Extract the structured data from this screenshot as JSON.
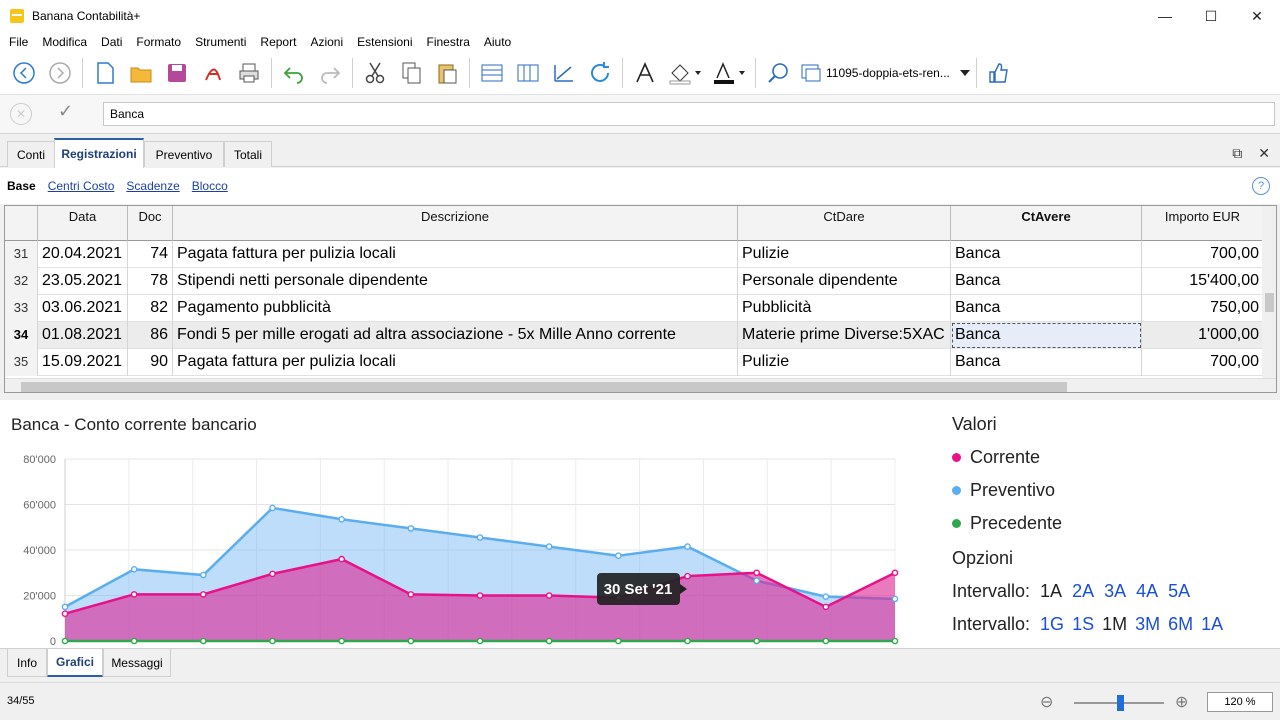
{
  "window": {
    "title": "Banana Contabilità+"
  },
  "menu": [
    "File",
    "Modifica",
    "Dati",
    "Formato",
    "Strumenti",
    "Report",
    "Azioni",
    "Estensioni",
    "Finestra",
    "Aiuto"
  ],
  "toolbar": {
    "file_name": "11095-doppia-ets-ren..."
  },
  "edit_field": {
    "value": "Banca"
  },
  "tabs": [
    "Conti",
    "Registrazioni",
    "Preventivo",
    "Totali"
  ],
  "active_tab": "Registrazioni",
  "subtabs": [
    "Base",
    "Centri Costo",
    "Scadenze",
    "Blocco"
  ],
  "table": {
    "columns": [
      "Data",
      "Doc",
      "Descrizione",
      "CtDare",
      "CtAvere",
      "Importo EUR"
    ],
    "rows": [
      {
        "n": "31",
        "data": "20.04.2021",
        "doc": "74",
        "desc": "Pagata fattura per pulizia locali",
        "dare": "Pulizie",
        "avere": "Banca",
        "importo": "700,00"
      },
      {
        "n": "32",
        "data": "23.05.2021",
        "doc": "78",
        "desc": "Stipendi netti personale dipendente",
        "dare": "Personale dipendente",
        "avere": "Banca",
        "importo": "15'400,00"
      },
      {
        "n": "33",
        "data": "03.06.2021",
        "doc": "82",
        "desc": "Pagamento pubblicità",
        "dare": "Pubblicità",
        "avere": "Banca",
        "importo": "750,00"
      },
      {
        "n": "34",
        "data": "01.08.2021",
        "doc": "86",
        "desc": "Fondi 5 per mille erogati ad altra associazione - 5x Mille Anno corrente",
        "dare": "Materie prime Diverse:5XAC",
        "avere": "Banca",
        "importo": "1'000,00"
      },
      {
        "n": "35",
        "data": "15.09.2021",
        "doc": "90",
        "desc": "Pagata fattura per pulizia locali",
        "dare": "Pulizie",
        "avere": "Banca",
        "importo": "700,00"
      }
    ]
  },
  "chart_panel": {
    "title": "Banca - Conto corrente bancario",
    "tooltip": "30 Set '21",
    "legend_heading": "Valori",
    "options_heading": "Opzioni",
    "interval_label": "Intervallo:",
    "interval_years": [
      "1A",
      "2A",
      "3A",
      "4A",
      "5A"
    ],
    "interval_periods": [
      "1G",
      "1S",
      "1M",
      "3M",
      "6M",
      "1A"
    ]
  },
  "chart_data": {
    "type": "area",
    "title": "Banca - Conto corrente bancario",
    "ylim": [
      0,
      80000
    ],
    "yticks": [
      "0",
      "20'000",
      "40'000",
      "60'000",
      "80'000"
    ],
    "grid": true,
    "legend_position": "right",
    "x_count": 14,
    "series": [
      {
        "name": "Corrente",
        "color": "#e8118a",
        "values": [
          12000,
          20500,
          20500,
          29500,
          36000,
          20500,
          20000,
          20000,
          19000,
          28500,
          30000,
          15000,
          30000
        ]
      },
      {
        "name": "Preventivo",
        "color": "#5aadee",
        "values": [
          15000,
          31500,
          29000,
          58500,
          53500,
          49500,
          45500,
          41500,
          37500,
          41500,
          26500,
          19500,
          18500
        ]
      },
      {
        "name": "Precedente",
        "color": "#2ea84a",
        "values": [
          0,
          0,
          0,
          0,
          0,
          0,
          0,
          0,
          0,
          0,
          0,
          0,
          0
        ]
      }
    ]
  },
  "bottom_tabs": [
    "Info",
    "Grafici",
    "Messaggi"
  ],
  "active_bottom_tab": "Grafici",
  "status": {
    "position": "34/55",
    "zoom": "120 %"
  }
}
